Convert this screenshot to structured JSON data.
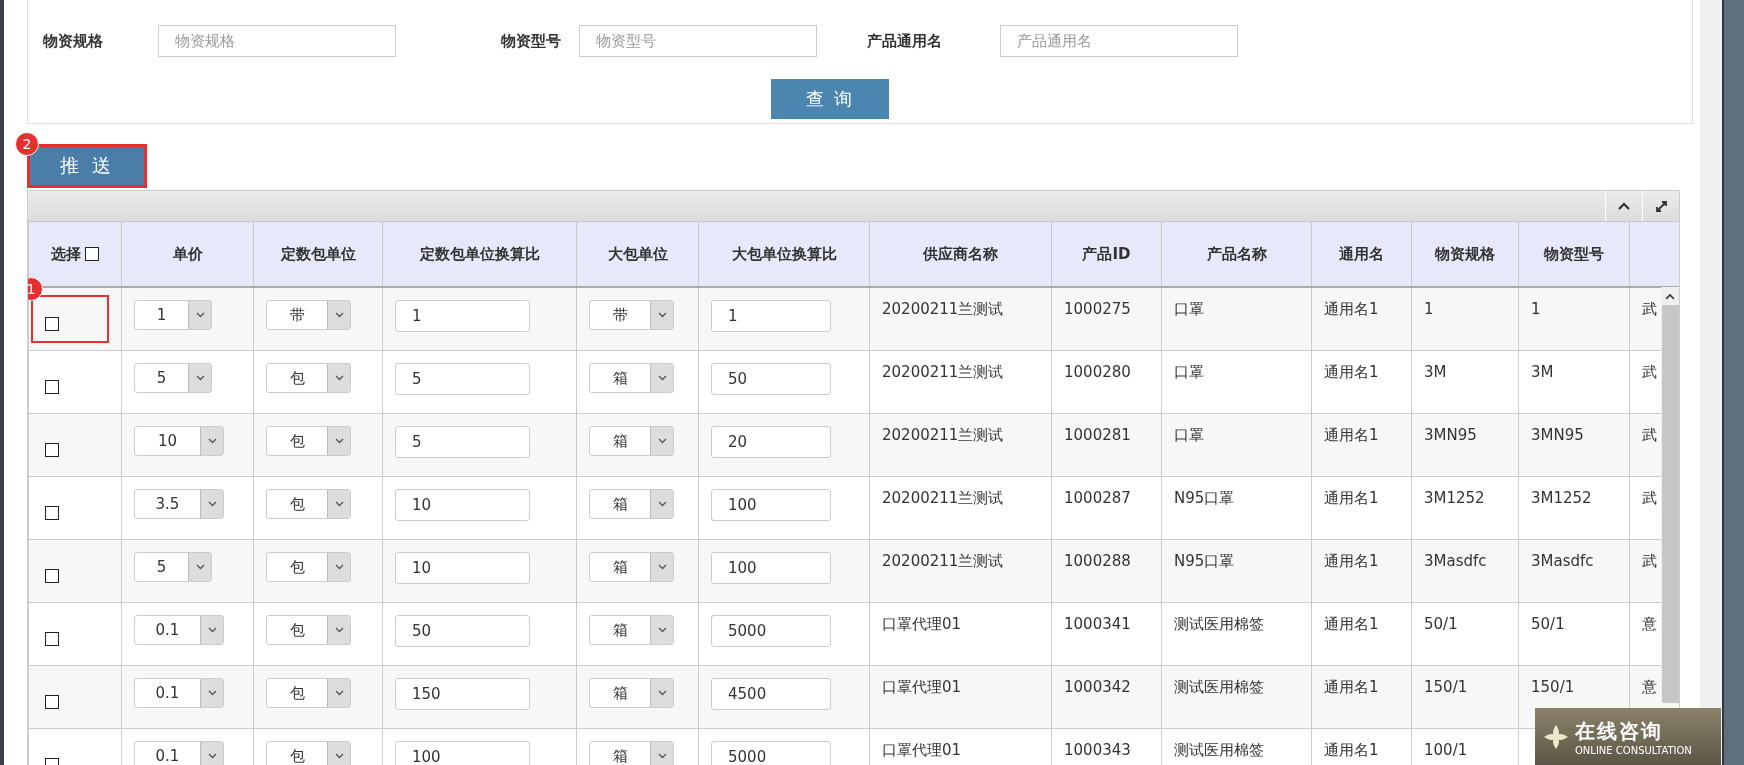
{
  "search_panel": {
    "fields": [
      {
        "label": "物资规格",
        "placeholder": "物资规格"
      },
      {
        "label": "物资型号",
        "placeholder": "物资型号"
      },
      {
        "label": "产品通用名",
        "placeholder": "产品通用名"
      }
    ],
    "query_button": "查 询"
  },
  "push_button": {
    "label": "推 送",
    "marker": "2"
  },
  "table": {
    "select_header": "选择",
    "select_all": false,
    "columns": [
      "单价",
      "定数包单位",
      "定数包单位换算比",
      "大包单位",
      "大包单位换算比",
      "供应商名称",
      "产品ID",
      "产品名称",
      "通用名",
      "物资规格",
      "物资型号"
    ],
    "rows": [
      {
        "selected": false,
        "marker": "1",
        "price": "1",
        "pack_unit": "带",
        "pack_ratio": "1",
        "big_unit": "带",
        "big_ratio": "1",
        "supplier": "20200211兰测试",
        "product_id": "1000275",
        "product_name": "口罩",
        "generic_name": "通用名1",
        "spec": "1",
        "model": "1",
        "column_13": "武"
      },
      {
        "selected": false,
        "price": "5",
        "pack_unit": "包",
        "pack_ratio": "5",
        "big_unit": "箱",
        "big_ratio": "50",
        "supplier": "20200211兰测试",
        "product_id": "1000280",
        "product_name": "口罩",
        "generic_name": "通用名1",
        "spec": "3M",
        "model": "3M",
        "column_13": "武"
      },
      {
        "selected": false,
        "price": "10",
        "pack_unit": "包",
        "pack_ratio": "5",
        "big_unit": "箱",
        "big_ratio": "20",
        "supplier": "20200211兰测试",
        "product_id": "1000281",
        "product_name": "口罩",
        "generic_name": "通用名1",
        "spec": "3MN95",
        "model": "3MN95",
        "column_13": "武"
      },
      {
        "selected": false,
        "price": "3.5",
        "pack_unit": "包",
        "pack_ratio": "10",
        "big_unit": "箱",
        "big_ratio": "100",
        "supplier": "20200211兰测试",
        "product_id": "1000287",
        "product_name": "N95口罩",
        "generic_name": "通用名1",
        "spec": "3M1252",
        "model": "3M1252",
        "column_13": "武"
      },
      {
        "selected": false,
        "price": "5",
        "pack_unit": "包",
        "pack_ratio": "10",
        "big_unit": "箱",
        "big_ratio": "100",
        "supplier": "20200211兰测试",
        "product_id": "1000288",
        "product_name": "N95口罩",
        "generic_name": "通用名1",
        "spec": "3Masdfc",
        "model": "3Masdfc",
        "column_13": "武"
      },
      {
        "selected": false,
        "price": "0.1",
        "pack_unit": "包",
        "pack_ratio": "50",
        "big_unit": "箱",
        "big_ratio": "5000",
        "supplier": "口罩代理01",
        "product_id": "1000341",
        "product_name": "测试医用棉签",
        "generic_name": "通用名1",
        "spec": "50/1",
        "model": "50/1",
        "column_13": "意"
      },
      {
        "selected": false,
        "price": "0.1",
        "pack_unit": "包",
        "pack_ratio": "150",
        "big_unit": "箱",
        "big_ratio": "4500",
        "supplier": "口罩代理01",
        "product_id": "1000342",
        "product_name": "测试医用棉签",
        "generic_name": "通用名1",
        "spec": "150/1",
        "model": "150/1",
        "column_13": "意"
      },
      {
        "selected": false,
        "price": "0.1",
        "pack_unit": "包",
        "pack_ratio": "100",
        "big_unit": "箱",
        "big_ratio": "5000",
        "supplier": "口罩代理01",
        "product_id": "1000343",
        "product_name": "测试医用棉签",
        "generic_name": "通用名1",
        "spec": "100/1"
      }
    ]
  },
  "consult_badge": {
    "title": "在线咨询",
    "subtitle": "ONLINE CONSULTATION"
  }
}
